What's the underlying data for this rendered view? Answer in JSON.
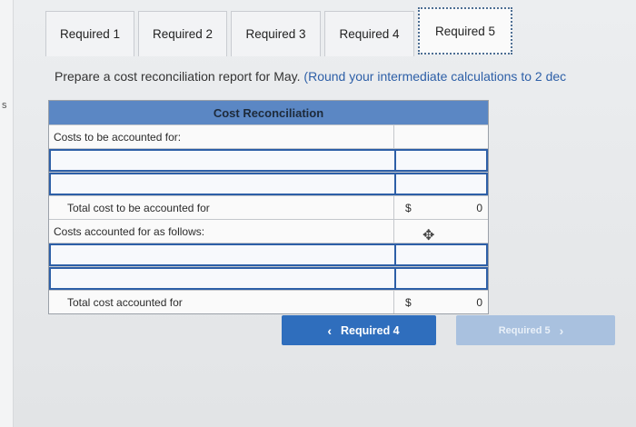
{
  "tabs": [
    "Required 1",
    "Required 2",
    "Required 3",
    "Required 4",
    "Required 5"
  ],
  "instruction": {
    "main": "Prepare a cost reconciliation report for May.",
    "note": "(Round your intermediate calculations to 2 dec"
  },
  "table": {
    "title": "Cost Reconciliation",
    "costs_to_account_label": "Costs to be accounted for:",
    "total_cost_to_account_label": "Total cost to be accounted for",
    "costs_accounted_label": "Costs accounted for as follows:",
    "total_cost_accounted_label": "Total cost accounted for",
    "currency_symbol": "$",
    "total_to_account_value": "0",
    "total_accounted_value": "0"
  },
  "nav": {
    "prev_label": "Required 4",
    "next_label": "Required 5"
  },
  "stray_text": "s",
  "colors": {
    "header": "#5b87c4",
    "primary_button": "#2f6ebd",
    "disabled_button": "#a9c1df"
  }
}
